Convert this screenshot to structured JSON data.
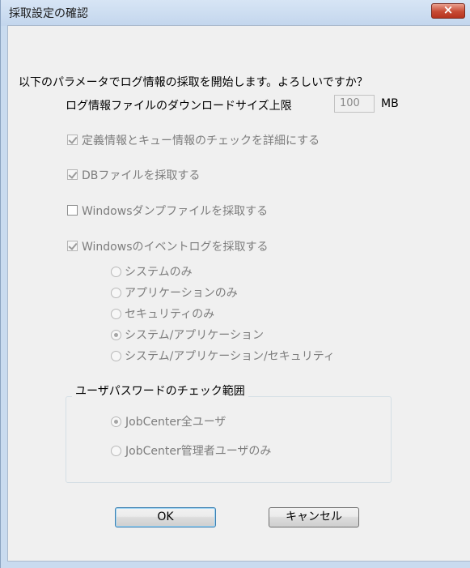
{
  "window": {
    "title": "採取設定の確認",
    "close_icon": "×"
  },
  "prompt": "以下のパラメータでログ情報の採取を開始します。よろしいですか？",
  "log_size": {
    "label": "ログ情報ファイルのダウンロードサイズ上限",
    "value": "100",
    "unit": "MB"
  },
  "checkboxes": [
    {
      "label": "定義情報とキュー情報のチェックを詳細にする",
      "checked": true,
      "enabled": false
    },
    {
      "label": "DBファイルを採取する",
      "checked": true,
      "enabled": false
    },
    {
      "label": "Windowsダンプファイルを採取する",
      "checked": false,
      "enabled": true
    },
    {
      "label": "Windowsのイベントログを採取する",
      "checked": true,
      "enabled": false
    }
  ],
  "event_log_options": [
    {
      "label": "システムのみ",
      "selected": false
    },
    {
      "label": "アプリケーションのみ",
      "selected": false
    },
    {
      "label": "セキュリティのみ",
      "selected": false
    },
    {
      "label": "システム/アプリケーション",
      "selected": true
    },
    {
      "label": "システム/アプリケーション/セキュリティ",
      "selected": false
    }
  ],
  "password_group": {
    "title": "ユーザパスワードのチェック範囲",
    "options": [
      {
        "label": "JobCenter全ユーザ",
        "selected": true
      },
      {
        "label": "JobCenter管理者ユーザのみ",
        "selected": false
      }
    ]
  },
  "buttons": {
    "ok": "OK",
    "cancel": "キャンセル"
  }
}
